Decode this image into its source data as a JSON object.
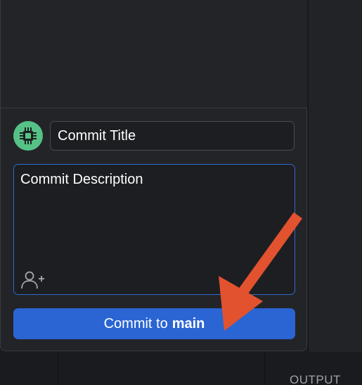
{
  "commit_panel": {
    "title_placeholder": "Commit Title",
    "description_placeholder": "Commit Description",
    "commit_button": {
      "prefix": "Commit to",
      "branch": "main"
    }
  },
  "bottom_panel": {
    "output_tab": "OUTPUT"
  },
  "icons": {
    "avatar": "chip-avatar-icon",
    "coauthor": "add-coauthor-icon",
    "annotation": "red-arrow"
  },
  "colors": {
    "accent_blue": "#2a65d3",
    "focus_border": "#2e6ad1",
    "avatar_green": "#56c186",
    "annotation_red": "#e2522f"
  }
}
